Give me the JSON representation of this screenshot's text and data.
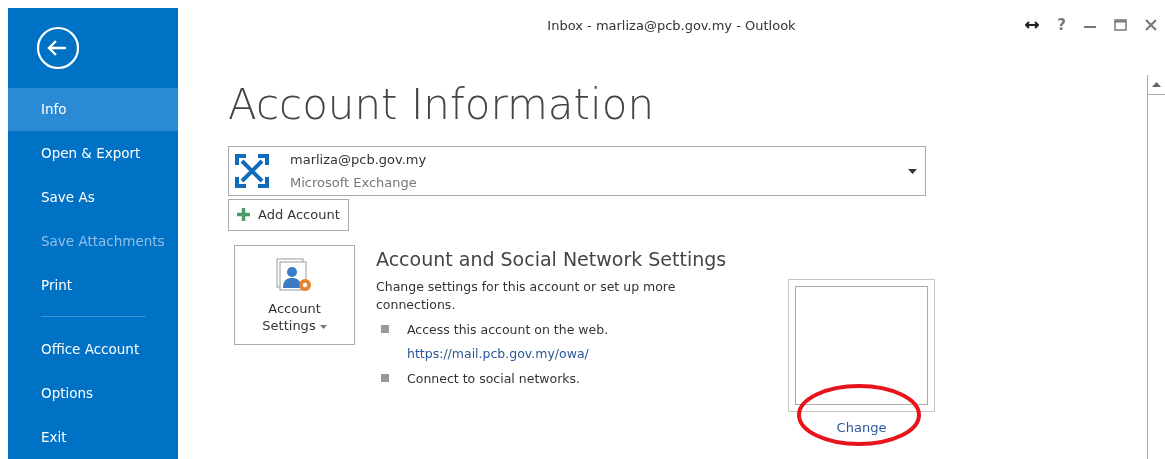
{
  "window": {
    "title": "Inbox - marliza@pcb.gov.my - Outlook",
    "help": "?"
  },
  "sidebar": {
    "items": [
      {
        "label": "Info",
        "selected": true,
        "disabled": false
      },
      {
        "label": "Open & Export",
        "selected": false,
        "disabled": false
      },
      {
        "label": "Save As",
        "selected": false,
        "disabled": false
      },
      {
        "label": "Save Attachments",
        "selected": false,
        "disabled": true
      },
      {
        "label": "Print",
        "selected": false,
        "disabled": false,
        "divider_after": true
      },
      {
        "label": "Office Account",
        "selected": false,
        "disabled": false
      },
      {
        "label": "Options",
        "selected": false,
        "disabled": false
      },
      {
        "label": "Exit",
        "selected": false,
        "disabled": false
      }
    ]
  },
  "page": {
    "title": "Account Information",
    "account": {
      "email": "marliza@pcb.gov.my",
      "type": "Microsoft Exchange"
    },
    "add_account": "Add Account",
    "settings_button": {
      "line1": "Account",
      "line2": "Settings"
    },
    "section": {
      "title": "Account and Social Network Settings",
      "description": "Change settings for this account or set up more connections.",
      "bullets": [
        {
          "text": "Access this account on the web.",
          "link": "https://mail.pcb.gov.my/owa/"
        },
        {
          "text": "Connect to social networks."
        }
      ]
    },
    "photo": {
      "change": "Change"
    }
  }
}
